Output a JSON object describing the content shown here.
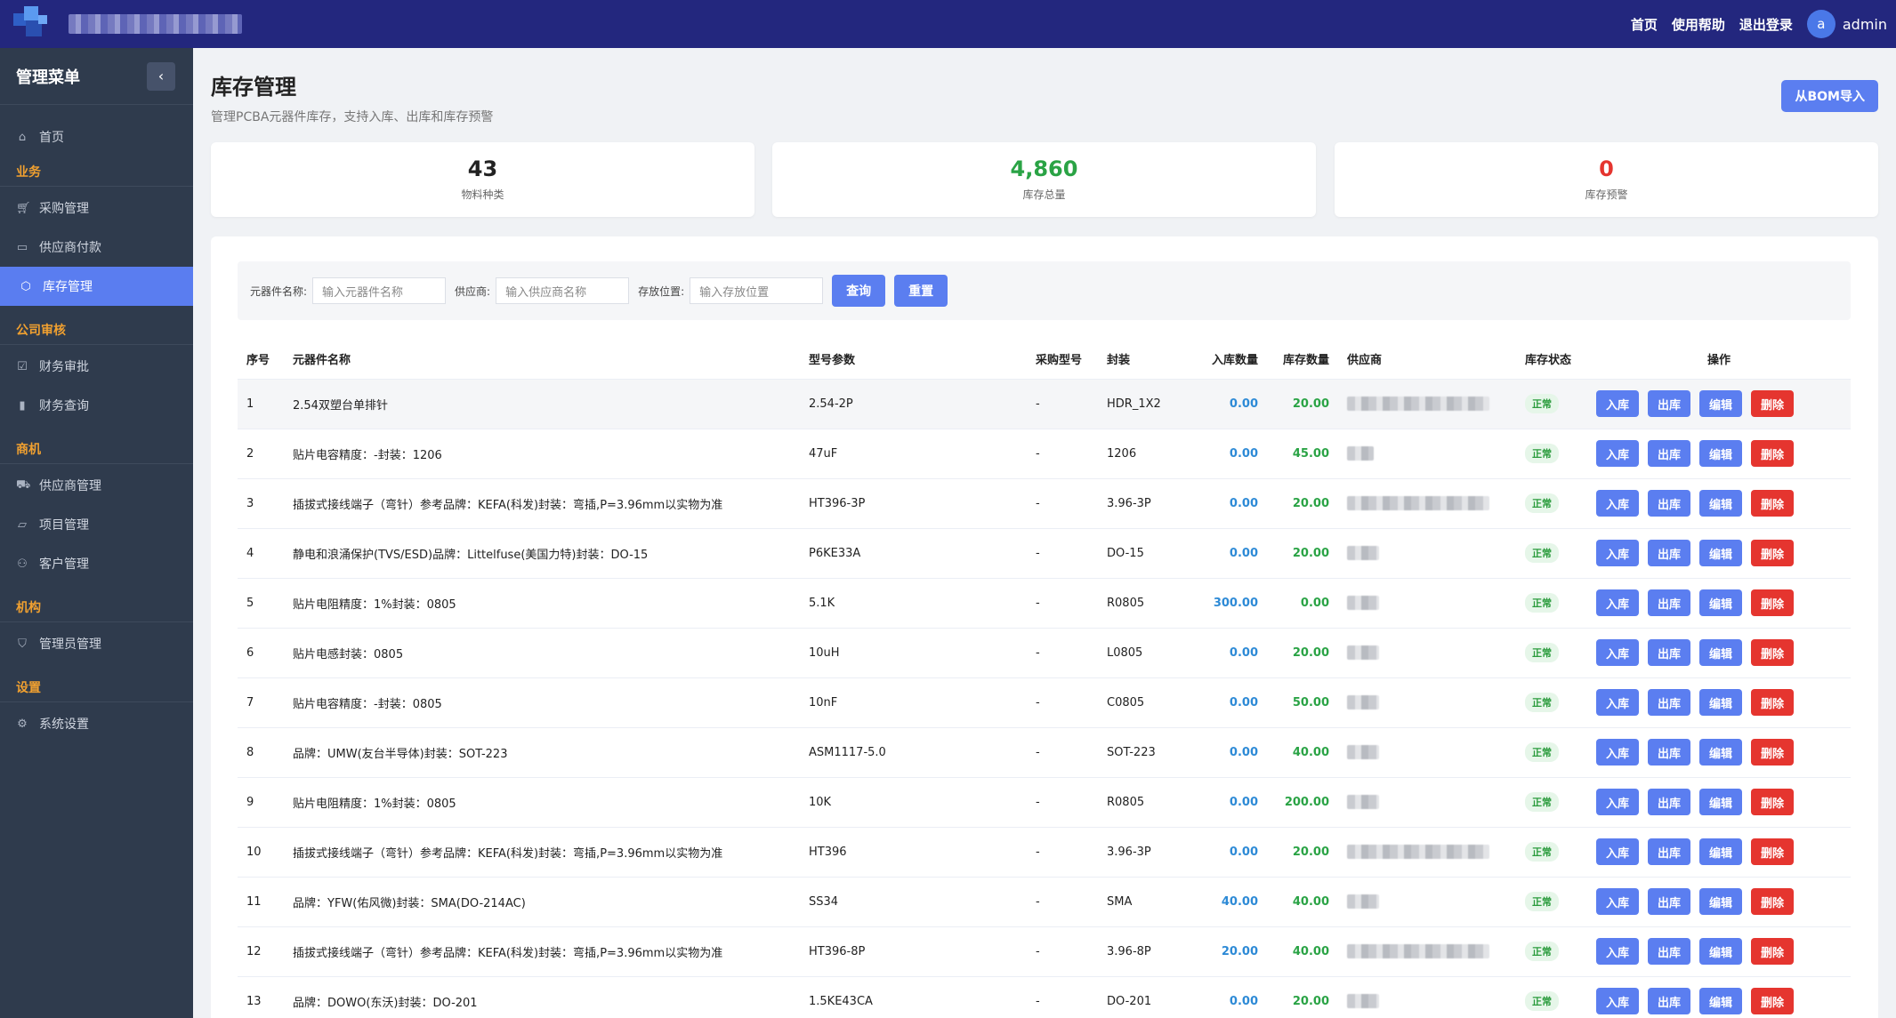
{
  "header": {
    "links": [
      "首页",
      "使用帮助",
      "退出登录"
    ],
    "avatar": "a",
    "username": "admin"
  },
  "sidebar": {
    "title": "管理菜单",
    "collapse_icon": "‹",
    "home": "首页",
    "groups": [
      {
        "label": "业务",
        "items": [
          "采购管理",
          "供应商付款",
          "库存管理"
        ]
      },
      {
        "label": "公司审核",
        "items": [
          "财务审批",
          "财务查询"
        ]
      },
      {
        "label": "商机",
        "items": [
          "供应商管理",
          "项目管理",
          "客户管理"
        ]
      },
      {
        "label": "机构",
        "items": [
          "管理员管理"
        ]
      },
      {
        "label": "设置",
        "items": [
          "系统设置"
        ]
      }
    ]
  },
  "page": {
    "title": "库存管理",
    "desc": "管理PCBA元器件库存，支持入库、出库和库存预警",
    "bom_button": "从BOM导入"
  },
  "stats": [
    {
      "value": "43",
      "label": "物料种类",
      "color": "#222222"
    },
    {
      "value": "4,860",
      "label": "库存总量",
      "color": "#2aa345"
    },
    {
      "value": "0",
      "label": "库存预警",
      "color": "#e5352f"
    }
  ],
  "search": {
    "name_label": "元器件名称:",
    "name_placeholder": "输入元器件名称",
    "supplier_label": "供应商:",
    "supplier_placeholder": "输入供应商名称",
    "location_label": "存放位置:",
    "location_placeholder": "输入存放位置",
    "query": "查询",
    "reset": "重置"
  },
  "table": {
    "headers": [
      "序号",
      "元器件名称",
      "型号参数",
      "采购型号",
      "封装",
      "入库数量",
      "库存数量",
      "供应商",
      "库存状态",
      "操作"
    ],
    "status": "正常",
    "actions": [
      "入库",
      "出库",
      "编辑",
      "删除"
    ],
    "rows": [
      {
        "no": "1",
        "name": "2.54双塑台单排针",
        "model": "2.54-2P",
        "purchase": "-",
        "pkg": "HDR_1X2",
        "in": "0.00",
        "stock": "20.00"
      },
      {
        "no": "2",
        "name": "贴片电容精度：-封装：1206",
        "model": "47uF",
        "purchase": "-",
        "pkg": "1206",
        "in": "0.00",
        "stock": "45.00"
      },
      {
        "no": "3",
        "name": "插拔式接线端子（弯针）参考品牌：KEFA(科发)封装：弯插,P=3.96mm以实物为准",
        "model": "HT396-3P",
        "purchase": "-",
        "pkg": "3.96-3P",
        "in": "0.00",
        "stock": "20.00"
      },
      {
        "no": "4",
        "name": "静电和浪涌保护(TVS/ESD)品牌：Littelfuse(美国力特)封装：DO-15",
        "model": "P6KE33A",
        "purchase": "-",
        "pkg": "DO-15",
        "in": "0.00",
        "stock": "20.00"
      },
      {
        "no": "5",
        "name": "贴片电阻精度：1%封装：0805",
        "model": "5.1K",
        "purchase": "-",
        "pkg": "R0805",
        "in": "300.00",
        "stock": "0.00"
      },
      {
        "no": "6",
        "name": "贴片电感封装：0805",
        "model": "10uH",
        "purchase": "-",
        "pkg": "L0805",
        "in": "0.00",
        "stock": "20.00"
      },
      {
        "no": "7",
        "name": "贴片电容精度：-封装：0805",
        "model": "10nF",
        "purchase": "-",
        "pkg": "C0805",
        "in": "0.00",
        "stock": "50.00"
      },
      {
        "no": "8",
        "name": "品牌：UMW(友台半导体)封装：SOT-223",
        "model": "ASM1117-5.0",
        "purchase": "-",
        "pkg": "SOT-223",
        "in": "0.00",
        "stock": "40.00"
      },
      {
        "no": "9",
        "name": "贴片电阻精度：1%封装：0805",
        "model": "10K",
        "purchase": "-",
        "pkg": "R0805",
        "in": "0.00",
        "stock": "200.00"
      },
      {
        "no": "10",
        "name": "插拔式接线端子（弯针）参考品牌：KEFA(科发)封装：弯插,P=3.96mm以实物为准",
        "model": "HT396",
        "purchase": "-",
        "pkg": "3.96-3P",
        "in": "0.00",
        "stock": "20.00"
      },
      {
        "no": "11",
        "name": "品牌：YFW(佑风微)封装：SMA(DO-214AC)",
        "model": "SS34",
        "purchase": "-",
        "pkg": "SMA",
        "in": "40.00",
        "stock": "40.00"
      },
      {
        "no": "12",
        "name": "插拔式接线端子（弯针）参考品牌：KEFA(科发)封装：弯插,P=3.96mm以实物为准",
        "model": "HT396-8P",
        "purchase": "-",
        "pkg": "3.96-8P",
        "in": "20.00",
        "stock": "40.00"
      },
      {
        "no": "13",
        "name": "品牌：DOWO(东沃)封装：DO-201",
        "model": "1.5KE43CA",
        "purchase": "-",
        "pkg": "DO-201",
        "in": "0.00",
        "stock": "20.00"
      }
    ]
  }
}
